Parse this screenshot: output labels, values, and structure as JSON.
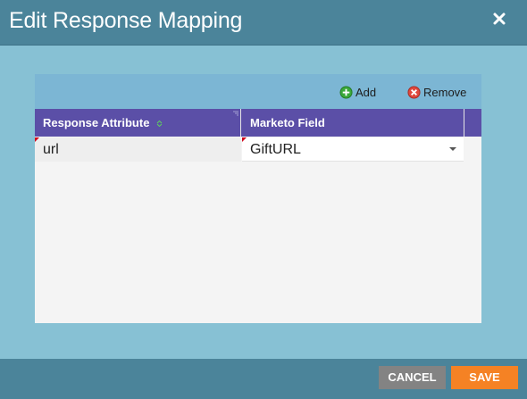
{
  "dialog": {
    "title": "Edit Response Mapping",
    "close_icon": "close-icon"
  },
  "toolbar": {
    "add_label": "Add",
    "add_icon": "plus-circle-icon",
    "remove_label": "Remove",
    "remove_icon": "x-circle-icon"
  },
  "grid": {
    "columns": [
      {
        "label": "Response Attribute",
        "sort_icon": "sort-icon"
      },
      {
        "label": "Marketo Field"
      }
    ],
    "rows": [
      {
        "attribute": "url",
        "field": "GiftURL"
      }
    ]
  },
  "footer": {
    "cancel_label": "CANCEL",
    "save_label": "SAVE"
  },
  "colors": {
    "header_bg": "#4b849a",
    "body_bg": "#87c1d4",
    "grid_header_bg": "#5b4fa7",
    "save_bg": "#f58224",
    "cancel_bg": "#838383"
  }
}
